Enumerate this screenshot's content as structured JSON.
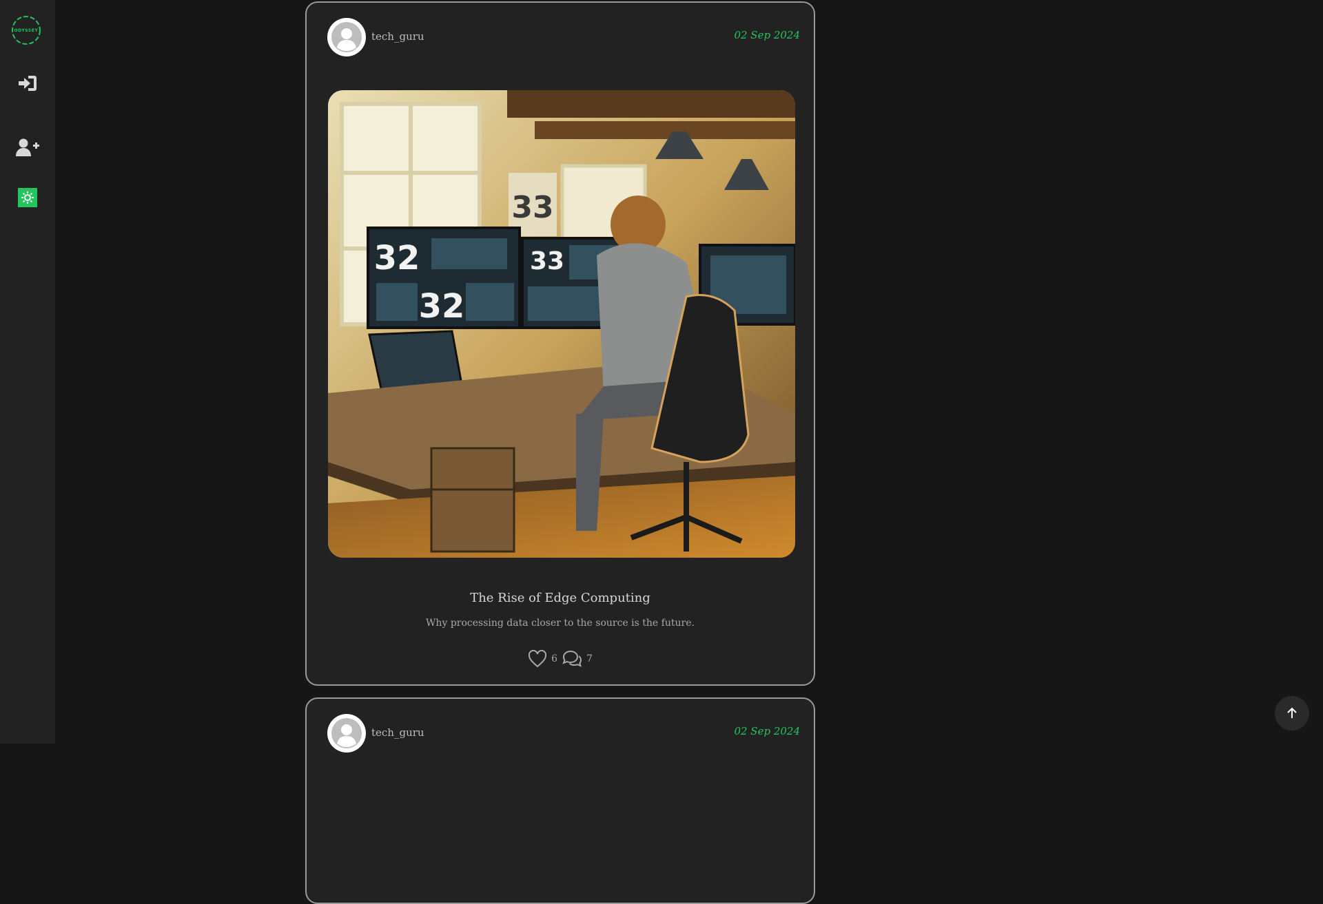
{
  "sidebar": {
    "logo_text": "ODYSSEY",
    "items": [
      {
        "name": "login",
        "icon": "sign-in-icon"
      },
      {
        "name": "register",
        "icon": "user-plus-icon"
      },
      {
        "name": "theme",
        "icon": "sun-icon"
      }
    ]
  },
  "colors": {
    "accent": "#22c55e",
    "background": "#161616",
    "sidebar": "#222222",
    "card_border": "#9a9a9a"
  },
  "posts": [
    {
      "username": "tech_guru",
      "date": "02 Sep 2024",
      "title": "The Rise of Edge Computing",
      "description": "Why processing data closer to the source is the future.",
      "likes": "6",
      "comments": "7",
      "image": {
        "alt": "Person working at a desk with multiple monitors showing dashboards",
        "screen_numbers": [
          "32",
          "33",
          "32",
          "33"
        ]
      }
    },
    {
      "username": "tech_guru",
      "date": "02 Sep 2024"
    }
  ]
}
